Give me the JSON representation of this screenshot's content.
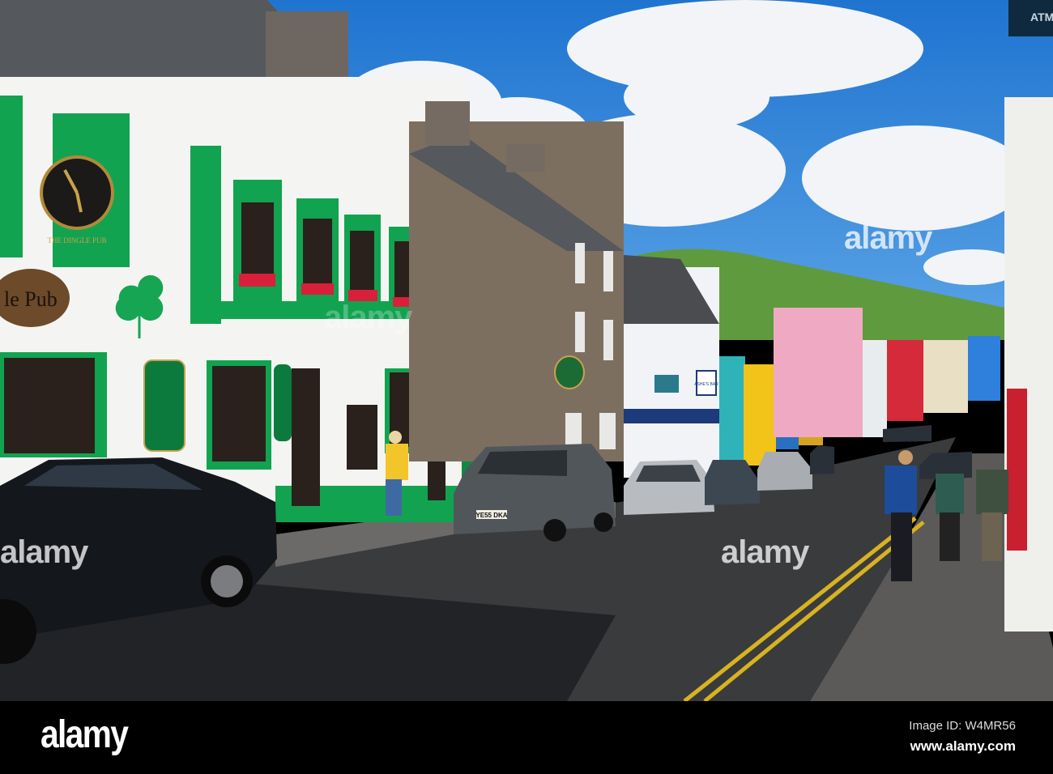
{
  "photo": {
    "signs": {
      "atm": "ATM",
      "pub_sign": "le Pub",
      "clock_label": "THE DINGLE PUB",
      "ashes_bar": "ASHE'S BAR",
      "plate_van": "YE55 DKA"
    },
    "watermarks": [
      "alamy",
      "alamy",
      "alamy",
      "alamy"
    ]
  },
  "footer": {
    "logo": "alamy",
    "image_id": "Image ID: W4MR56",
    "url": "www.alamy.com"
  }
}
